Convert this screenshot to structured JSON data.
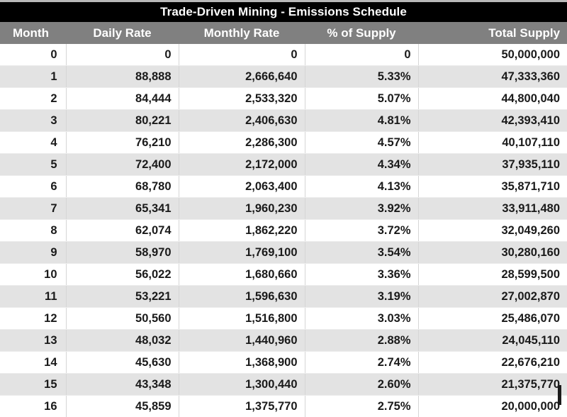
{
  "table": {
    "title": "Trade-Driven Mining - Emissions Schedule",
    "columns": [
      {
        "key": "month",
        "label": "Month"
      },
      {
        "key": "daily",
        "label": "Daily Rate"
      },
      {
        "key": "monthly",
        "label": "Monthly Rate"
      },
      {
        "key": "pct",
        "label": "% of Supply"
      },
      {
        "key": "total",
        "label": "Total Supply"
      }
    ],
    "rows": [
      {
        "month": "0",
        "daily": "0",
        "monthly": "0",
        "pct": "0",
        "total": "50,000,000"
      },
      {
        "month": "1",
        "daily": "88,888",
        "monthly": "2,666,640",
        "pct": "5.33%",
        "total": "47,333,360"
      },
      {
        "month": "2",
        "daily": "84,444",
        "monthly": "2,533,320",
        "pct": "5.07%",
        "total": "44,800,040"
      },
      {
        "month": "3",
        "daily": "80,221",
        "monthly": "2,406,630",
        "pct": "4.81%",
        "total": "42,393,410"
      },
      {
        "month": "4",
        "daily": "76,210",
        "monthly": "2,286,300",
        "pct": "4.57%",
        "total": "40,107,110"
      },
      {
        "month": "5",
        "daily": "72,400",
        "monthly": "2,172,000",
        "pct": "4.34%",
        "total": "37,935,110"
      },
      {
        "month": "6",
        "daily": "68,780",
        "monthly": "2,063,400",
        "pct": "4.13%",
        "total": "35,871,710"
      },
      {
        "month": "7",
        "daily": "65,341",
        "monthly": "1,960,230",
        "pct": "3.92%",
        "total": "33,911,480"
      },
      {
        "month": "8",
        "daily": "62,074",
        "monthly": "1,862,220",
        "pct": "3.72%",
        "total": "32,049,260"
      },
      {
        "month": "9",
        "daily": "58,970",
        "monthly": "1,769,100",
        "pct": "3.54%",
        "total": "30,280,160"
      },
      {
        "month": "10",
        "daily": "56,022",
        "monthly": "1,680,660",
        "pct": "3.36%",
        "total": "28,599,500"
      },
      {
        "month": "11",
        "daily": "53,221",
        "monthly": "1,596,630",
        "pct": "3.19%",
        "total": "27,002,870"
      },
      {
        "month": "12",
        "daily": "50,560",
        "monthly": "1,516,800",
        "pct": "3.03%",
        "total": "25,486,070"
      },
      {
        "month": "13",
        "daily": "48,032",
        "monthly": "1,440,960",
        "pct": "2.88%",
        "total": "24,045,110"
      },
      {
        "month": "14",
        "daily": "45,630",
        "monthly": "1,368,900",
        "pct": "2.74%",
        "total": "22,676,210"
      },
      {
        "month": "15",
        "daily": "43,348",
        "monthly": "1,300,440",
        "pct": "2.60%",
        "total": "21,375,770"
      },
      {
        "month": "16",
        "daily": "45,859",
        "monthly": "1,375,770",
        "pct": "2.75%",
        "total": "20,000,000"
      }
    ]
  },
  "colors": {
    "title_bar": "#000000",
    "header_bar": "#808080",
    "row_alt": "#e3e3e3",
    "row_base": "#ffffff",
    "text": "#1a1a1a"
  }
}
